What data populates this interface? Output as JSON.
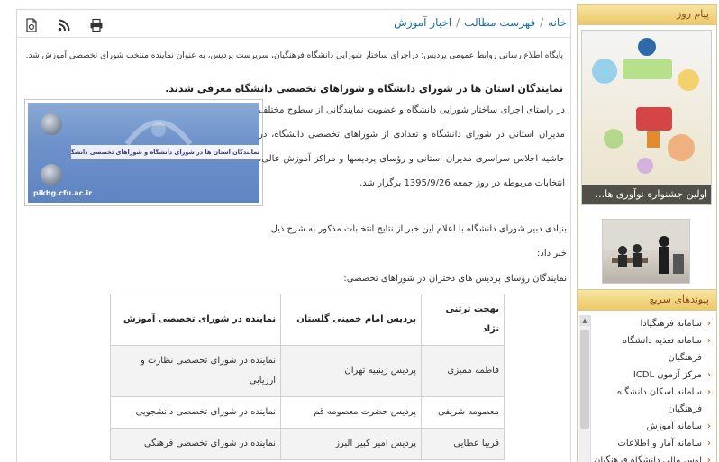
{
  "breadcrumb": {
    "home": "خانه",
    "list": "فهرست مطالب",
    "category": "اخبار آموزش"
  },
  "toolbar": {
    "print_icon": "print-icon",
    "rss_icon": "rss-icon",
    "pdf_icon": "pdf-icon"
  },
  "article": {
    "summary": "پایگاه اطلاع رسانی روابط عمومی پردیس: دراجرای ساختار شورایی دانشگاه فرهنگیان، سرپرست پردیس، به عنوان نماینده منتخب شورای تخصصی آموزش شد.",
    "headline": "نمایندگان استان ها در شورای دانشگاه و شوراهای تخصصی دانشگاه معرفی شدند.",
    "banner_text": "نمایندگان استان ها در شورای دانشگاه و شوراهای تخصصی دانشگاه معرفی شدند",
    "banner_site": "pikhg.cfu.ac.ir",
    "paragraph1": "در راستای اجرای ساختار شورایی دانشگاه و عضویت نمایندگانی از سطوح مختلف مدیران استانی در شورای دانشگاه و تعدادی از شوراهای تخصصی دانشگاه، در حاشیه اجلاس سراسری مدیران استانی و رؤسای پردیسها و مراکز آموزش عالی، انتخابات مربوطه در روز جمعه 1395/9/26 برگزار شد.",
    "paragraph2": "بنیادی دبیر شورای دانشگاه با اعلام این خبر از نتایج انتخابات مذکور به شرح ذیل خبر داد:",
    "reps_heading": "نمایندگان رؤسای پردیس های دختران در شوراهای تخصصی:",
    "table": {
      "headers": [
        "بهجت ترتنی نژاد",
        "پردیس امام خمینی گلستان",
        "نماینده در شورای تخصصی آموزش"
      ],
      "rows": [
        [
          "فاطمه ممیزی",
          "پردیس زینبیه تهران",
          "نماینده در شورای تخصصی نظارت و ارزیابی"
        ],
        [
          "معصومه شریفی",
          "پردیس حضرت معصومه قم",
          "نماینده در شورای تخصصی دانشجویی"
        ],
        [
          "فریبا عطایی",
          "پردیس امیر کبیر البرز",
          "نماینده در شورای تخصصی فرهنگی"
        ]
      ]
    }
  },
  "sidebar": {
    "message_title": "پیام روز",
    "poster_caption": "اولین جشنواره نوآوری ها...",
    "links_title": "پیوندهای سریع",
    "links": [
      "سامانه فرهنگیادا",
      "سامانه تغذیه دانشگاه فرهنگیان",
      "مرکز آزمون ICDL",
      "سامانه اسکان دانشگاه فرهنگیان",
      "سامانه آموزش",
      "سامانه آمار و اطلاعات",
      "لوس مالی دانشگاه فرهنگیان"
    ]
  },
  "colors": {
    "link": "#1a6fa8",
    "panel_header": "#ecc96a",
    "bullet": "#d06a1a"
  }
}
